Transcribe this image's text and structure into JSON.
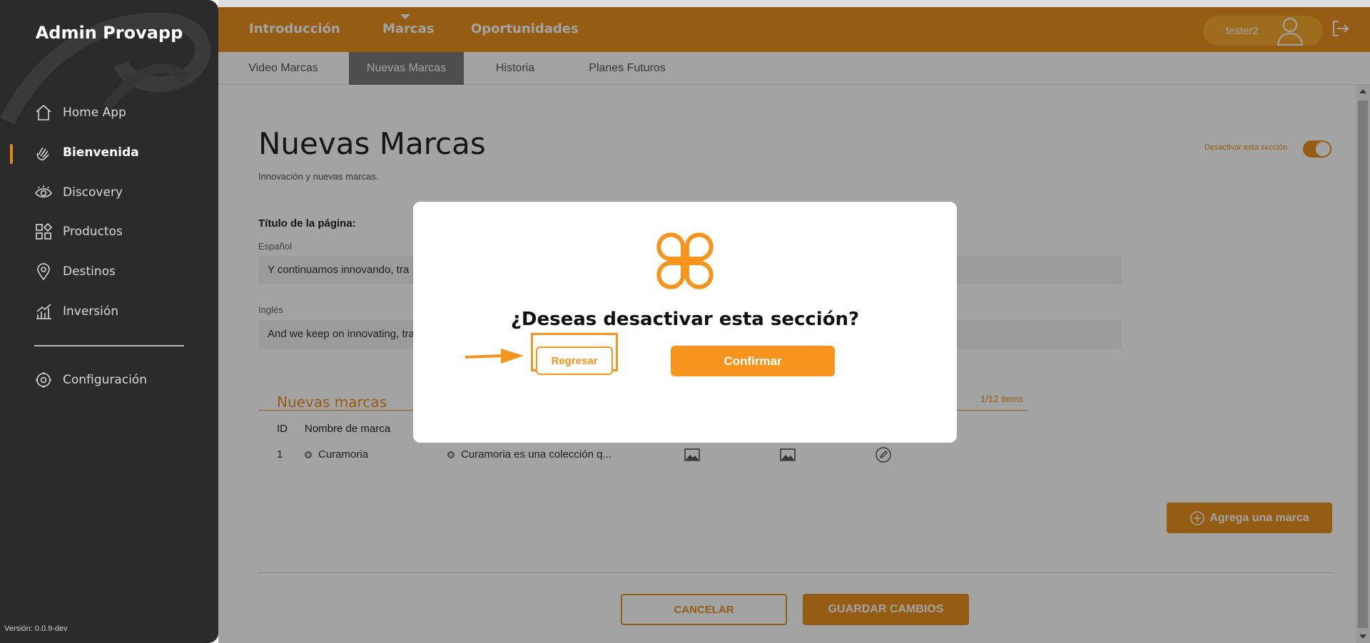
{
  "sidebar": {
    "title": "Admin Provapp",
    "items": [
      {
        "label": "Home App",
        "icon": "home-icon"
      },
      {
        "label": "Bienvenida",
        "icon": "waving-hand-icon"
      },
      {
        "label": "Discovery",
        "icon": "eye-icon"
      },
      {
        "label": "Productos",
        "icon": "grid-icon"
      },
      {
        "label": "Destinos",
        "icon": "location-pin-icon"
      },
      {
        "label": "Inversión",
        "icon": "bar-chart-icon"
      }
    ],
    "config_label": "Configuración",
    "version": "Versión: 0.0.9-dev"
  },
  "topnav": {
    "tabs": [
      "Introducción",
      "Marcas",
      "Oportunidades"
    ],
    "active_tab": "Marcas",
    "username": "tester2"
  },
  "subnav": {
    "tabs": [
      "Video Marcas",
      "Nuevas Marcas",
      "Historia",
      "Planes Futuros"
    ],
    "active_tab": "Nuevas Marcas"
  },
  "page": {
    "title": "Nuevas Marcas",
    "subtitle": "Innovación y nuevas marcas.",
    "toggle_label": "Desactivar esta sección",
    "toggle_on": true,
    "section_label": "Título de la página:",
    "spanish_label": "Español",
    "spanish_value": "Y continuamos innovando, tra",
    "english_label": "Inglés",
    "english_value": "And we keep on innovating, tra"
  },
  "brands": {
    "title": "Nuevas marcas",
    "count": "1/12 items",
    "headers": [
      "ID",
      "Nombre de marca"
    ],
    "rows": [
      {
        "id": "1",
        "name": "Curamoria",
        "description": "Curamoria es una colección q..."
      }
    ],
    "add_label": "Agrega una marca"
  },
  "actions": {
    "cancel": "CANCELAR",
    "save": "GUARDAR CAMBIOS"
  },
  "modal": {
    "title": "¿Deseas desactivar esta sección?",
    "back": "Regresar",
    "confirm": "Confirmar"
  },
  "colors": {
    "accent": "#e9901e",
    "modal_accent": "#f7941d",
    "sidebar_bg": "#2b2b2b"
  }
}
